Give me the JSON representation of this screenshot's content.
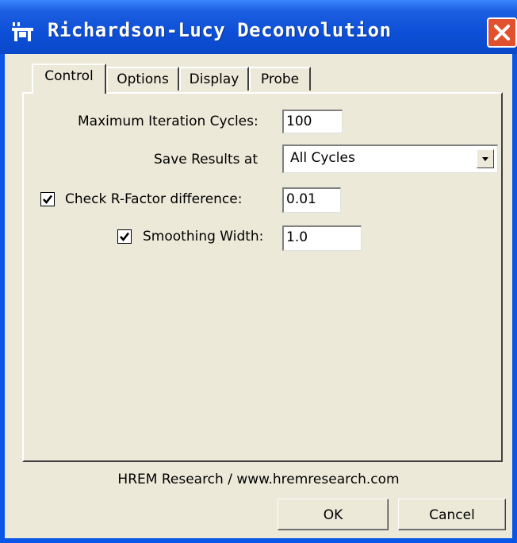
{
  "window": {
    "title": "Richardson-Lucy Deconvolution",
    "title_icon": "app-icon",
    "close_icon": "close-icon"
  },
  "tabs": [
    {
      "label": "Control",
      "active": true
    },
    {
      "label": "Options",
      "active": false
    },
    {
      "label": "Display",
      "active": false
    },
    {
      "label": "Probe",
      "active": false
    }
  ],
  "control": {
    "max_iter_label": "Maximum Iteration Cycles:",
    "max_iter_value": "100",
    "save_results_label": "Save Results at",
    "save_results_value": "All Cycles",
    "rfactor_label": "Check R-Factor difference:",
    "rfactor_checked": true,
    "rfactor_value": "0.01",
    "smoothing_label": "Smoothing Width:",
    "smoothing_checked": true,
    "smoothing_value": "1.0"
  },
  "footer": {
    "credit": "HREM Research / www.hremresearch.com",
    "ok_label": "OK",
    "cancel_label": "Cancel"
  },
  "colors": {
    "titlebar": "#0a48c9",
    "close_button": "#e2512f",
    "dialog_bg": "#ece9d8"
  }
}
